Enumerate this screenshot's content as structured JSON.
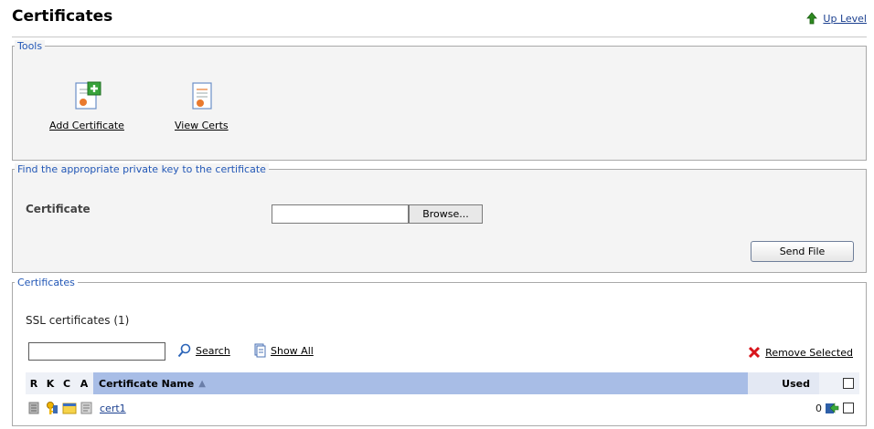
{
  "page": {
    "title": "Certificates",
    "up_level_label": "Up Level"
  },
  "tools": {
    "legend": "Tools",
    "add_certificate_label": "Add Certificate",
    "view_certs_label": "View Certs"
  },
  "private_key": {
    "legend": "Find the appropriate private key to the certificate",
    "certificate_label": "Certificate",
    "file_value": "",
    "browse_label": "Browse...",
    "send_file_label": "Send File"
  },
  "certificates": {
    "legend": "Certificates",
    "ssl_count_text": "SSL certificates (1)",
    "search_value": "",
    "search_label": "Search",
    "show_all_label": "Show All",
    "remove_selected_label": "Remove Selected",
    "columns": {
      "r": "R",
      "k": "K",
      "c": "C",
      "a": "A",
      "name": "Certificate Name",
      "sort_indicator": "▲",
      "used": "Used"
    },
    "rows": [
      {
        "name": "cert1",
        "used": "0",
        "selected": false
      }
    ]
  },
  "icons": {
    "up_level": "up-arrow-icon",
    "add_certificate": "add-certificate-icon",
    "view_certs": "view-certs-icon",
    "search": "magnifier-icon",
    "show_all": "show-all-icon",
    "remove": "red-x-icon",
    "row_r": "server-icon",
    "row_k": "key-icon",
    "row_c": "certificate-folder-icon",
    "row_a": "authority-icon",
    "row_action": "export-arrow-icon"
  },
  "colors": {
    "link": "#1a3f8f",
    "legend": "#2257b6",
    "panel_bg": "#f4f4f4",
    "header_active": "#a8bde6",
    "remove_x": "#d8141b",
    "up_arrow": "#2d8a1f"
  }
}
